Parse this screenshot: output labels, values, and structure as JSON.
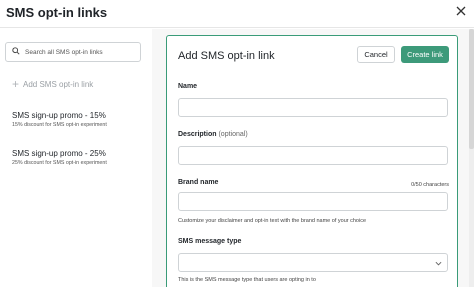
{
  "header": {
    "title": "SMS opt-in links",
    "close_icon": "close-icon"
  },
  "sidebar": {
    "search_placeholder": "Search all SMS opt-in links",
    "add_label": "Add SMS opt-in link",
    "items": [
      {
        "title": "SMS sign-up promo - 15%",
        "subtitle": "15% discount for SMS opt-in experiment"
      },
      {
        "title": "SMS sign-up promo - 25%",
        "subtitle": "25% discount for SMS opt-in experiment"
      }
    ]
  },
  "form": {
    "title": "Add SMS opt-in link",
    "cancel_label": "Cancel",
    "create_label": "Create link",
    "name_label": "Name",
    "name_value": "",
    "description_label": "Description",
    "description_optional": "(optional)",
    "description_value": "",
    "brand_label": "Brand name",
    "brand_counter": "0/50 characters",
    "brand_value": "",
    "brand_help": "Customize your disclaimer and opt-in text with the brand name of your choice",
    "message_type_label": "SMS message type",
    "message_type_value": "",
    "message_type_help": "This is the SMS message type that users are opting in to"
  },
  "colors": {
    "accent": "#3d9a7a",
    "panel_border": "#3a9b78",
    "background": "#f7f7f7"
  }
}
